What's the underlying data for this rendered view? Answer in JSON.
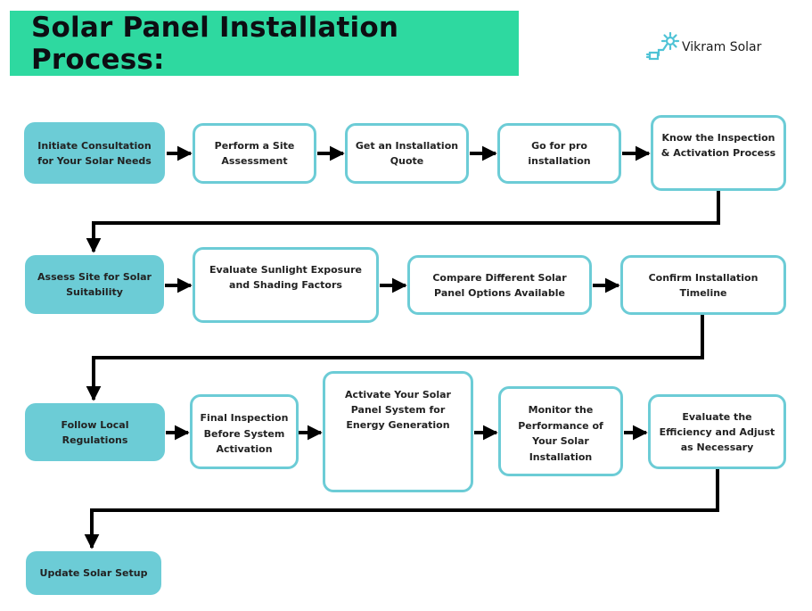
{
  "header": {
    "title": "Solar Panel Installation Process:",
    "brand_name": "Vikram Solar",
    "brand_icon": "sun-plug-icon"
  },
  "colors": {
    "title_banner": "#2ed9a0",
    "node_fill": "#6cccd6",
    "node_border": "#6cccd6",
    "arrow": "#000000",
    "text": "#222222"
  },
  "rows": [
    {
      "nodes": [
        {
          "label": "Initiate Consultation for Your Solar Needs",
          "style": "filled"
        },
        {
          "label": "Perform a Site Assessment",
          "style": "outline"
        },
        {
          "label": "Get an Installation Quote",
          "style": "outline"
        },
        {
          "label": "Go for pro installation",
          "style": "outline"
        },
        {
          "label": "Know the Inspection & Activation Process",
          "style": "outline"
        }
      ]
    },
    {
      "nodes": [
        {
          "label": "Assess Site for Solar Suitability",
          "style": "filled"
        },
        {
          "label": "Evaluate Sunlight Exposure and Shading Factors",
          "style": "outline"
        },
        {
          "label": "Compare Different Solar Panel Options Available",
          "style": "outline"
        },
        {
          "label": "Confirm Installation Timeline",
          "style": "outline"
        }
      ]
    },
    {
      "nodes": [
        {
          "label": "Follow Local Regulations",
          "style": "filled"
        },
        {
          "label": "Final Inspection Before System Activation",
          "style": "outline"
        },
        {
          "label": "Activate Your Solar Panel System for Energy Generation",
          "style": "outline"
        },
        {
          "label": "Monitor the Performance of Your Solar Installation",
          "style": "outline"
        },
        {
          "label": "Evaluate the Efficiency and Adjust as Necessary",
          "style": "outline"
        }
      ]
    },
    {
      "nodes": [
        {
          "label": "Update Solar Setup",
          "style": "filled"
        }
      ]
    }
  ]
}
